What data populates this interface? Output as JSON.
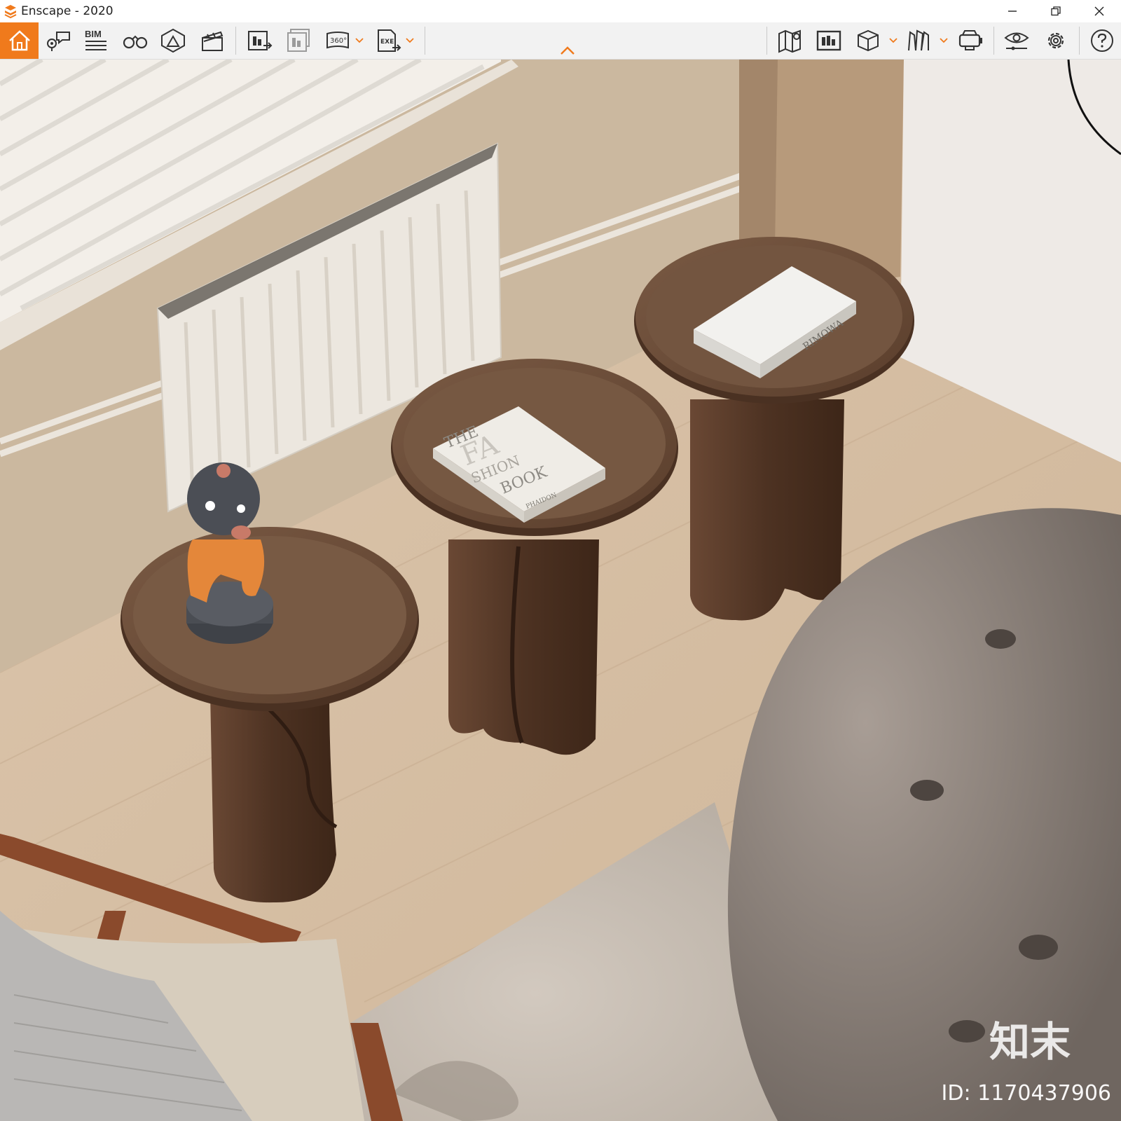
{
  "window": {
    "title": "Enscape - 2020",
    "controls": [
      "minimize",
      "restore",
      "close"
    ]
  },
  "toolbar": {
    "left_tools": [
      {
        "name": "home",
        "icon": "home-icon",
        "active": true
      },
      {
        "name": "views",
        "icon": "map-pin-chat-icon"
      },
      {
        "name": "bim",
        "icon": "bim-list-icon",
        "label": "BIM"
      },
      {
        "name": "binoculars",
        "icon": "binoculars-icon"
      },
      {
        "name": "atmosphere",
        "icon": "mountain-icon"
      },
      {
        "name": "video-editor",
        "icon": "clapperboard-icon"
      },
      {
        "name": "screenshot-export",
        "icon": "render-export-icon"
      },
      {
        "name": "batch-export",
        "icon": "batch-export-icon"
      },
      {
        "name": "panorama",
        "icon": "panorama-360-icon",
        "label": "360°"
      },
      {
        "name": "exe-export",
        "icon": "exe-export-icon",
        "label": "EXE"
      }
    ],
    "right_tools": [
      {
        "name": "map",
        "icon": "map-icon"
      },
      {
        "name": "asset-library",
        "icon": "asset-library-icon"
      },
      {
        "name": "box",
        "icon": "cube-icon"
      },
      {
        "name": "material",
        "icon": "material-icon"
      },
      {
        "name": "vr",
        "icon": "vr-headset-icon"
      },
      {
        "name": "visual-settings",
        "icon": "eye-icon"
      },
      {
        "name": "settings",
        "icon": "gear-icon"
      },
      {
        "name": "help",
        "icon": "help-icon"
      }
    ],
    "accent_color": "#f07a1c"
  },
  "viewport": {
    "watermark_brand": "知末",
    "watermark_id": "ID: 1170437906",
    "book_center": {
      "line1": "THE",
      "line2": "FA",
      "line3": "SHION",
      "line4": "BOOK",
      "publisher": "PHAIDON"
    },
    "book_right": {
      "spine": "RIMOWA"
    }
  }
}
